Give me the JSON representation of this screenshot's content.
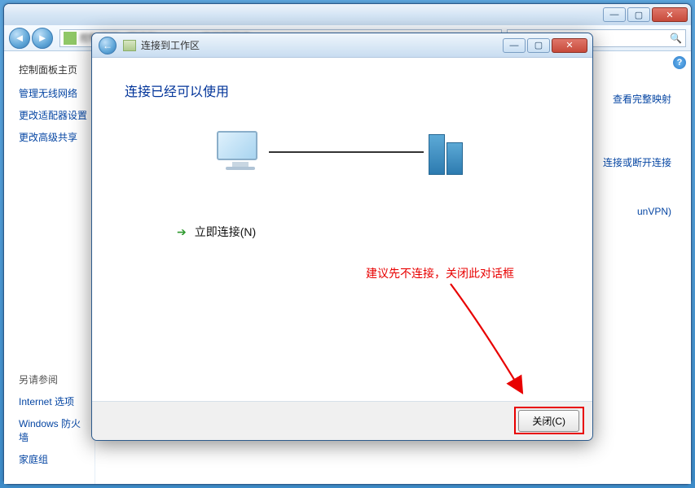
{
  "outer": {
    "toolbar": {
      "breadcrumb": "控制面板 › 网络和 Internet › 连接到网络"
    },
    "left": {
      "heading": "控制面板主页",
      "links": [
        "管理无线网络",
        "更改适配器设置",
        "更改高级共享"
      ],
      "subheading": "另请参阅",
      "footer_links": [
        "Internet 选项",
        "Windows 防火墙",
        "家庭组"
      ]
    },
    "right": {
      "links": [
        "查看完整映射",
        "连接或断开连接",
        "unVPN)"
      ]
    }
  },
  "dialog": {
    "title": "连接到工作区",
    "heading": "连接已经可以使用",
    "connect_now": "立即连接(N)",
    "annotation": "建议先不连接，关闭此对话框",
    "close_button": "关闭(C)"
  },
  "win_controls": {
    "min": "—",
    "max": "▢",
    "close": "✕"
  }
}
